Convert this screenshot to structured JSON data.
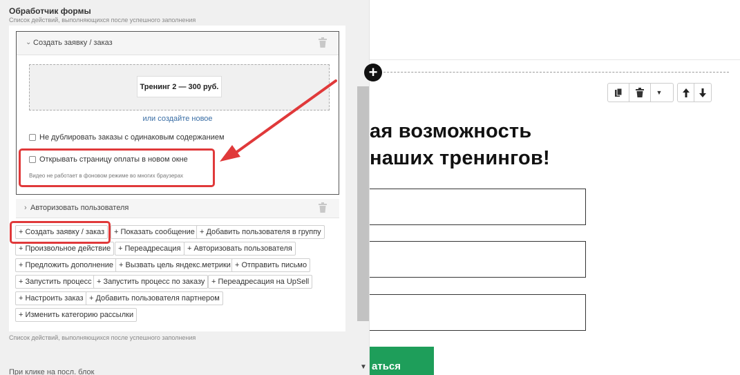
{
  "panel": {
    "title": "Обработчик формы",
    "subtitle": "Список действий, выполняющихся после успешного заполнения",
    "subtitle_bottom": "Список действий, выполняющихся после успешного заполнения",
    "bottom_label": "При клике на посл. блок"
  },
  "action_card": {
    "label": "Создать заявку / заказ",
    "product": "Тренинг 2 — 300 руб.",
    "create_link": "или создайте новое",
    "no_duplicate_label": "Не дублировать заказы с одинаковым содержанием",
    "new_window_label": "Открывать страницу оплаты в новом окне",
    "new_window_note": "Видео не работает в фоновом режиме во многих браузерах"
  },
  "auth_row": {
    "label": "Авторизовать пользователя"
  },
  "actions": [
    "+ Создать заявку / заказ",
    "+ Показать сообщение",
    "+ Добавить пользователя в группу",
    "+ Произвольное действие",
    "+ Переадресация",
    "+ Авторизовать пользователя",
    "+ Предложить дополнение",
    "+ Вызвать цель яндекс.метрики",
    "+ Отправить письмо",
    "+ Запустить процесс",
    "+ Запустить процесс по заказу",
    "+ Переадресация на UpSell",
    "+ Настроить заказ",
    "+ Добавить пользователя партнером",
    "+ Изменить категорию рассылки"
  ],
  "canvas": {
    "heading_line1": "ая возможность",
    "heading_line2": "наших тренингов!",
    "submit_label": "аться"
  },
  "colors": {
    "highlight": "#e0393a",
    "submit_bg": "#1e9e5a",
    "link": "#3a6ea5"
  }
}
